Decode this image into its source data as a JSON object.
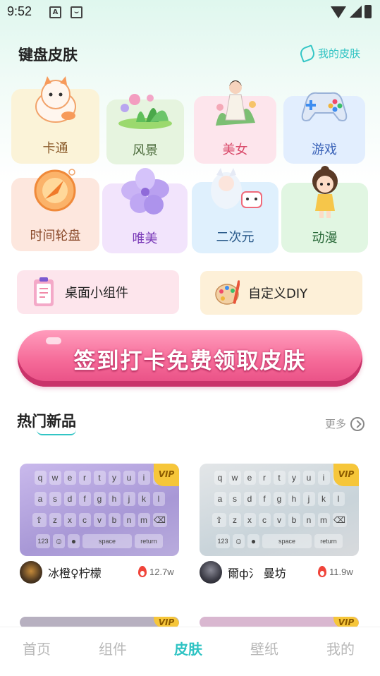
{
  "status_bar": {
    "time": "9:52"
  },
  "header": {
    "title": "键盘皮肤",
    "my_skin": "我的皮肤"
  },
  "categories": [
    {
      "label": "卡通"
    },
    {
      "label": "风景"
    },
    {
      "label": "美女"
    },
    {
      "label": "游戏"
    },
    {
      "label": "时间轮盘"
    },
    {
      "label": "唯美"
    },
    {
      "label": "二次元"
    },
    {
      "label": "动漫"
    }
  ],
  "tools": {
    "widget": "桌面小组件",
    "diy": "自定义DIY"
  },
  "signin_banner": "签到打卡免费领取皮肤",
  "hot_section": {
    "title": "热门新品",
    "more": "更多"
  },
  "keyboard": {
    "row1": [
      "q",
      "w",
      "e",
      "r",
      "t",
      "y",
      "u",
      "i",
      "o"
    ],
    "row2": [
      "a",
      "s",
      "d",
      "f",
      "g",
      "h",
      "j",
      "k",
      "l"
    ],
    "row3": [
      "z",
      "x",
      "c",
      "v",
      "b",
      "n",
      "m"
    ],
    "num": "123",
    "space": "space",
    "return": "return",
    "vip": "VIP"
  },
  "products": [
    {
      "author": "冰橙♀柠檬",
      "hot": "12.7w"
    },
    {
      "author": "爾ф氵 曼坊",
      "hot": "11.9w"
    }
  ],
  "nav": {
    "items": [
      "首页",
      "组件",
      "皮肤",
      "壁纸",
      "我的"
    ],
    "active": "皮肤"
  },
  "colors": {
    "accent": "#2ec3c3",
    "banner": "#f56a98",
    "vip": "#f6c63a"
  }
}
